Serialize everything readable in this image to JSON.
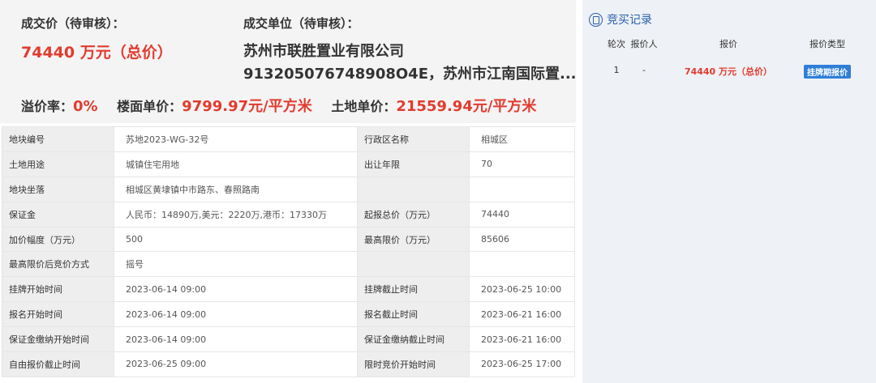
{
  "summary": {
    "deal_price_label": "成交价（待审核）：",
    "deal_price_value": "74440 万元（总价）",
    "deal_unit_label": "成交单位（待审核）：",
    "company_line1": "苏州市联胜置业有限公司",
    "company_line2": "913205076748908O4E，苏州市江南国际置...",
    "premium_label": "溢价率：",
    "premium_value": "0%",
    "floor_price_label": "楼面单价：",
    "floor_price_value": "9799.97元/平方米",
    "land_price_label": "土地单价：",
    "land_price_value": "21559.94元/平方米"
  },
  "table": {
    "rows": [
      {
        "k1": "地块编号",
        "v1": "苏地2023-WG-32号",
        "k2": "行政区名称",
        "v2": "相城区"
      },
      {
        "k1": "土地用途",
        "v1": "城镇住宅用地",
        "k2": "出让年限",
        "v2": "70"
      },
      {
        "k1": "地块坐落",
        "v1": "相城区黄埭镇中市路东、春照路南",
        "k2": "",
        "v2": ""
      },
      {
        "k1": "保证金",
        "v1": "人民币：14890万,美元：2220万,港币：17330万",
        "k2": "起报总价（万元）",
        "v2": "74440"
      },
      {
        "k1": "加价幅度（万元）",
        "v1": "500",
        "k2": "最高限价（万元）",
        "v2": "85606"
      },
      {
        "k1": "最高限价后竞价方式",
        "v1": "摇号",
        "k2": "",
        "v2": ""
      },
      {
        "k1": "挂牌开始时间",
        "v1": "2023-06-14 09:00",
        "k2": "挂牌截止时间",
        "v2": "2023-06-25 10:00"
      },
      {
        "k1": "报名开始时间",
        "v1": "2023-06-14 09:00",
        "k2": "报名截止时间",
        "v2": "2023-06-21 16:00"
      },
      {
        "k1": "保证金缴纳开始时间",
        "v1": "2023-06-14 09:00",
        "k2": "保证金缴纳截止时间",
        "v2": "2023-06-21 16:00"
      },
      {
        "k1": "自由报价截止时间",
        "v1": "2023-06-25 09:00",
        "k2": "限时竞价开始时间",
        "v2": "2023-06-25 17:00"
      }
    ]
  },
  "bids": {
    "title": "竞买记录",
    "headers": {
      "round": "轮次",
      "bidder": "报价人",
      "price": "报价",
      "type": "报价类型"
    },
    "rows": [
      {
        "round": "1",
        "bidder": "-",
        "price": "74440 万元（总价）",
        "type": "挂牌期报价"
      }
    ]
  },
  "colors": {
    "accent_red": "#e23b2e",
    "accent_blue": "#2a5fb0",
    "badge_blue": "#2f7ed8"
  }
}
